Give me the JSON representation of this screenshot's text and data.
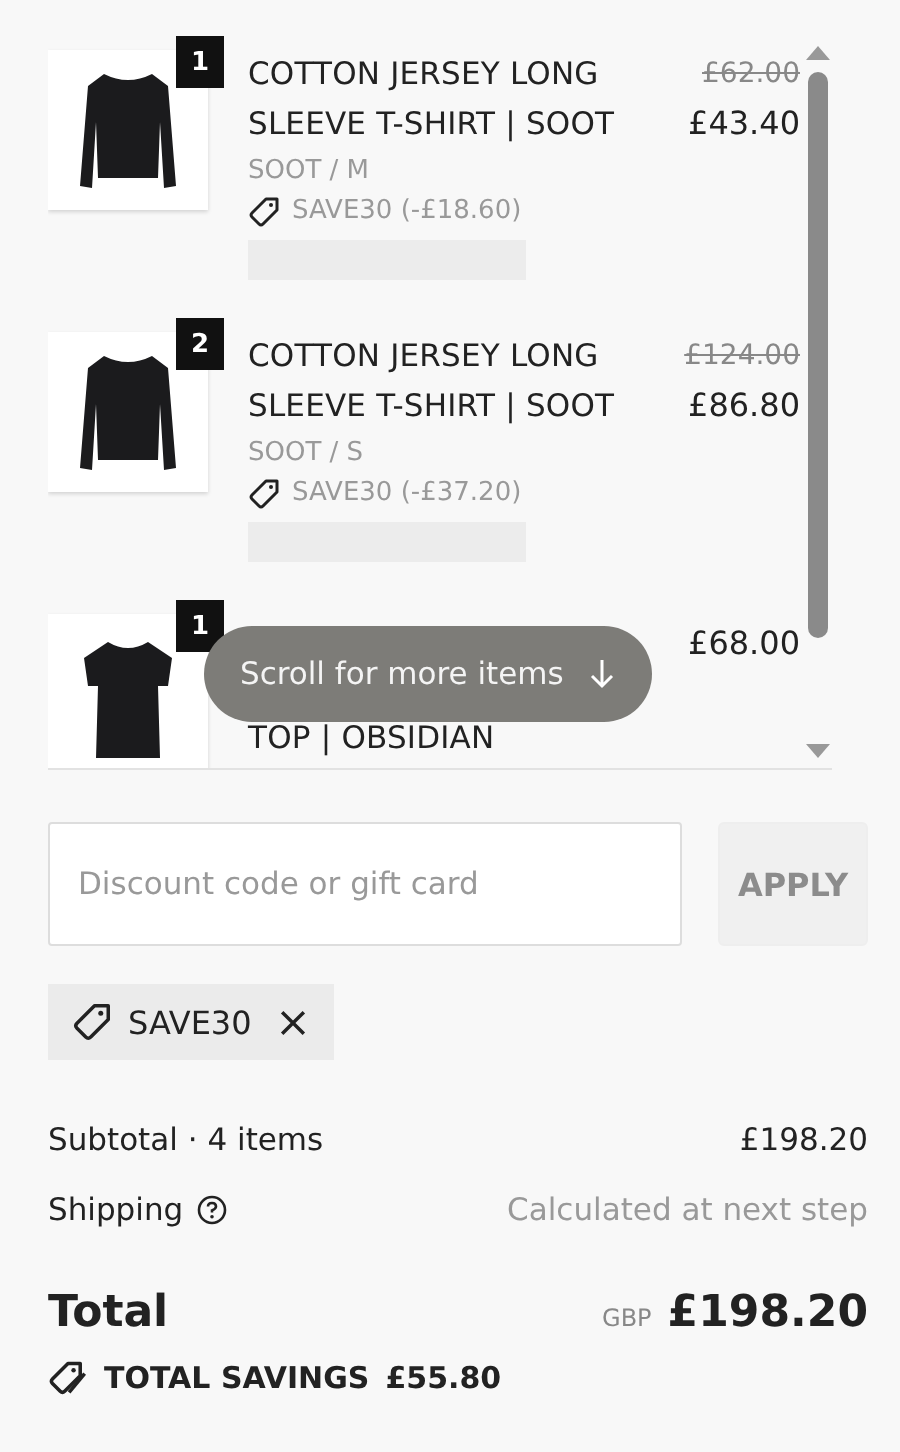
{
  "items": [
    {
      "quantity": "1",
      "kind": "full",
      "title": "COTTON JERSEY LONG SLEEVE T-SHIRT | SOOT",
      "original_price": "£62.00",
      "price": "£43.40",
      "variant": "SOOT / M",
      "discount": "SAVE30 (-£18.60)"
    },
    {
      "quantity": "2",
      "kind": "full",
      "title": "COTTON JERSEY LONG SLEEVE T-SHIRT | SOOT",
      "original_price": "£124.00",
      "price": "£86.80",
      "variant": "SOOT / S",
      "discount": "SAVE30 (-£37.20)"
    },
    {
      "quantity": "1",
      "kind": "covered",
      "title": "TOP | OBSIDIAN",
      "price": "£68.00"
    }
  ],
  "scroll_hint": "Scroll for more items",
  "discount_field": {
    "placeholder": "Discount code or gift card"
  },
  "apply_button": {
    "label": "APPLY",
    "disabled": true
  },
  "applied_code": "SAVE30",
  "subtotal": {
    "label": "Subtotal · 4 items",
    "value": "£198.20"
  },
  "shipping": {
    "label": "Shipping",
    "value": "Calculated at next step"
  },
  "total": {
    "label": "Total",
    "currency": "GBP",
    "value": "£198.20"
  },
  "savings": {
    "label": "TOTAL SAVINGS",
    "value": "£55.80"
  }
}
